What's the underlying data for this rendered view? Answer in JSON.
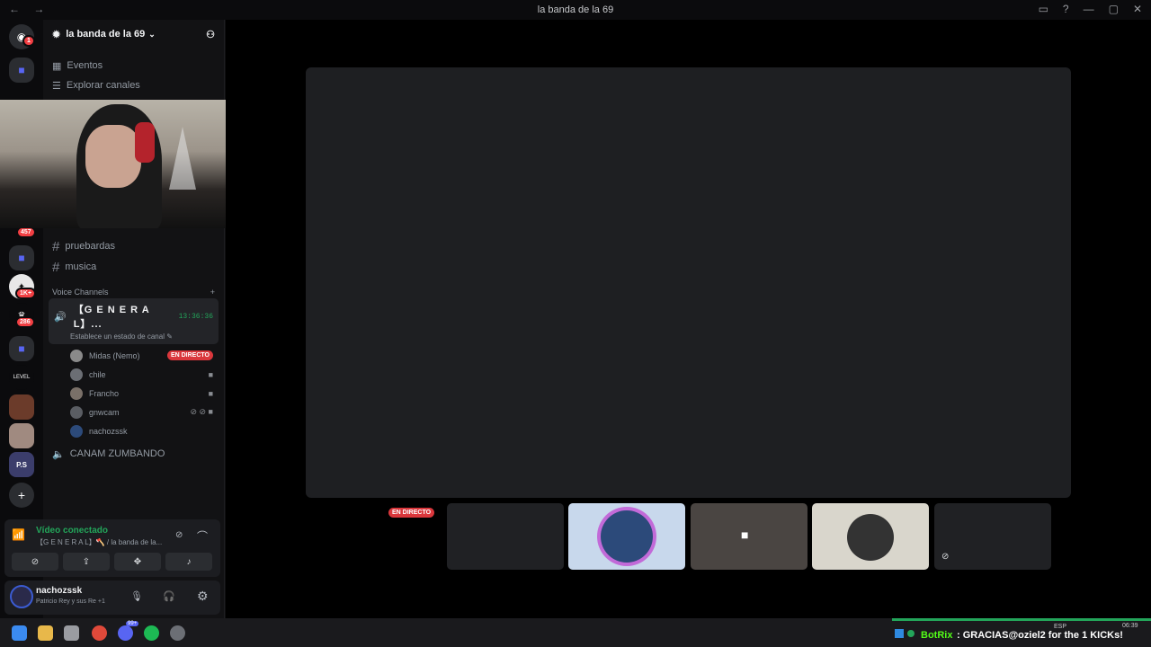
{
  "window": {
    "title": "la banda de la 69",
    "nav": "← →"
  },
  "guilds": {
    "badges": {
      "dm": "1",
      "g1": "457",
      "g2": "1K+",
      "g3": "286"
    },
    "level_label": "LEVEL",
    "ps_label": "P.S"
  },
  "server": {
    "name": "la banda de la 69",
    "menu": [
      {
        "label": "Eventos"
      },
      {
        "label": "Explorar canales"
      }
    ],
    "text_channels": [
      {
        "name": "pruebardas"
      },
      {
        "name": "musica"
      }
    ],
    "voice_category": "Voice Channels",
    "active_voice": {
      "name": "【G E N E R A L】...",
      "timer": "13:36:36",
      "status_prompt": "Establece un estado de canal",
      "members": [
        {
          "name": "Midas (Nemo)",
          "live": "EN DIRECTO"
        },
        {
          "name": "chile"
        },
        {
          "name": "Francho"
        },
        {
          "name": "gnwcam"
        },
        {
          "name": "nachozssk"
        }
      ]
    },
    "other_voice": "CANAM ZUMBANDO"
  },
  "voice_panel": {
    "status": "Vídeo conectado",
    "channel": "【G E N E R A L】🪓 / la banda de la..."
  },
  "user_panel": {
    "username": "nachozssk",
    "activity": "Patricio Rey y sus Re +1"
  },
  "stage": {
    "live_badge": "EN DIRECTO"
  },
  "taskbar": {
    "chat_user": "BotRix",
    "chat_message": ": GRACIAS@oziel2 for the 1 KICKs!",
    "lang": "ESP",
    "time": "06:39",
    "discord_badge": "99+"
  },
  "colors": {
    "accent": "#5865f2",
    "live": "#da373c",
    "green": "#23a55a",
    "bg": "#000000"
  }
}
